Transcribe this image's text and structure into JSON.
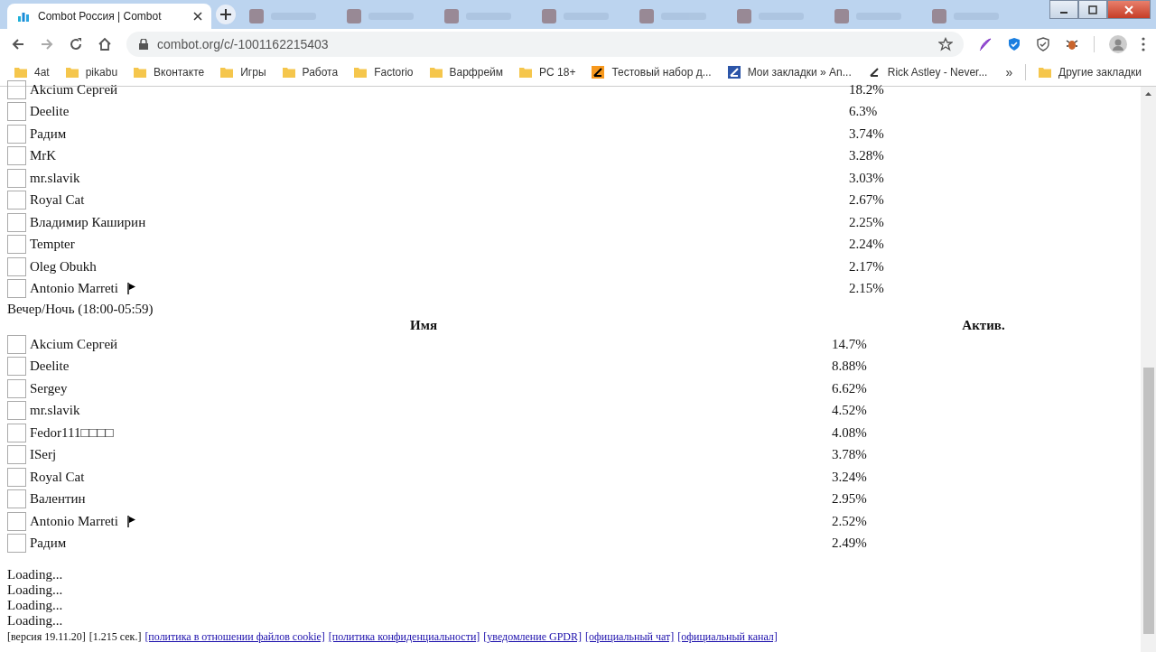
{
  "browser": {
    "tabs": [
      {
        "title": "Combot Россия | Combot",
        "selected": true
      },
      {
        "selected": false
      },
      {
        "selected": false
      },
      {
        "selected": false
      },
      {
        "selected": false
      },
      {
        "selected": false
      },
      {
        "selected": false
      },
      {
        "selected": false
      },
      {
        "selected": false
      }
    ],
    "url": "combot.org/c/-1001162215403",
    "bookmarks": [
      {
        "label": "4at",
        "kind": "folder"
      },
      {
        "label": "pikabu",
        "kind": "folder"
      },
      {
        "label": "Вконтакте",
        "kind": "folder"
      },
      {
        "label": "Игры",
        "kind": "folder"
      },
      {
        "label": "Работа",
        "kind": "folder"
      },
      {
        "label": "Factorio",
        "kind": "folder"
      },
      {
        "label": "Варфрейм",
        "kind": "folder"
      },
      {
        "label": "PC 18+",
        "kind": "folder"
      },
      {
        "label": "Тестовый набор д...",
        "kind": "site"
      },
      {
        "label": "Мои закладки » An...",
        "kind": "site"
      },
      {
        "label": "Rick Astley - Never...",
        "kind": "site"
      }
    ],
    "overflow": "»",
    "other_bookmarks": "Другие закладки"
  },
  "top_table": {
    "rows": [
      {
        "name": "Akcium Сергей",
        "value": "18.2%",
        "checked": false,
        "flag": false
      },
      {
        "name": "Deelite",
        "value": "6.3%",
        "checked": false,
        "flag": false
      },
      {
        "name": "Радим",
        "value": "3.74%",
        "checked": false,
        "flag": false
      },
      {
        "name": "MrK",
        "value": "3.28%",
        "checked": false,
        "flag": false
      },
      {
        "name": "mr.slavik",
        "value": "3.03%",
        "checked": false,
        "flag": false
      },
      {
        "name": "Royal Cat",
        "value": "2.67%",
        "checked": false,
        "flag": false
      },
      {
        "name": "Владимир Каширин",
        "value": "2.25%",
        "checked": false,
        "flag": false
      },
      {
        "name": "Tempter",
        "value": "2.24%",
        "checked": false,
        "flag": false
      },
      {
        "name": "Oleg Obukh",
        "value": "2.17%",
        "checked": false,
        "flag": false
      },
      {
        "name": "Antonio Marreti",
        "value": "2.15%",
        "checked": false,
        "flag": true
      }
    ]
  },
  "section_title": "Вечер/Ночь (18:00-05:59)",
  "table": {
    "columns": [
      "Имя",
      "Актив."
    ],
    "rows": [
      {
        "name": "Akcium Сергей",
        "value": "14.7%",
        "checked": false,
        "flag": false
      },
      {
        "name": "Deelite",
        "value": "8.88%",
        "checked": false,
        "flag": false
      },
      {
        "name": "Sergey",
        "value": "6.62%",
        "checked": false,
        "flag": false
      },
      {
        "name": "mr.slavik",
        "value": "4.52%",
        "checked": false,
        "flag": false
      },
      {
        "name": "Fedor111□□□□",
        "value": "4.08%",
        "checked": false,
        "flag": false
      },
      {
        "name": "ISerj",
        "value": "3.78%",
        "checked": false,
        "flag": false
      },
      {
        "name": "Royal Cat",
        "value": "3.24%",
        "checked": false,
        "flag": false
      },
      {
        "name": "Валентин",
        "value": "2.95%",
        "checked": false,
        "flag": false
      },
      {
        "name": "Antonio Marreti",
        "value": "2.52%",
        "checked": false,
        "flag": true
      },
      {
        "name": "Радим",
        "value": "2.49%",
        "checked": false,
        "flag": false
      }
    ]
  },
  "loading": [
    "Loading...",
    "Loading...",
    "Loading...",
    "Loading..."
  ],
  "footer": {
    "version": "[версия 19.11.20]",
    "time": "[1.215 сек.]",
    "links": [
      "[политика в отношении файлов cookie]",
      "[политика конфиденциальности]",
      "[уведомление GPDR]",
      "[официальный чат]",
      "[официальный канал]"
    ]
  }
}
